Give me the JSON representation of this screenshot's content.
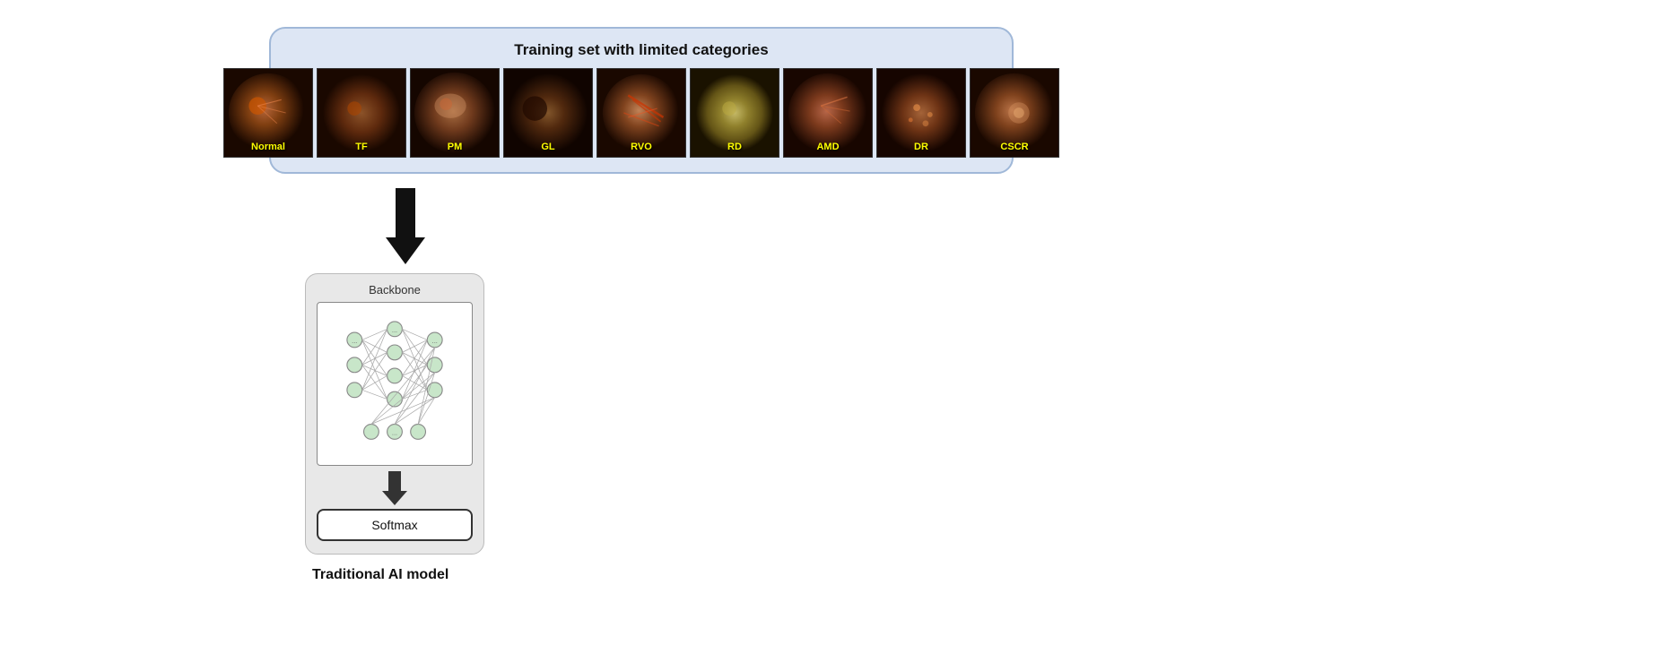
{
  "training_box": {
    "title": "Training set with limited categories"
  },
  "eye_images": [
    {
      "label": "Normal",
      "hue": "warm_brown",
      "id": "normal"
    },
    {
      "label": "TF",
      "hue": "dark_brown",
      "id": "tf"
    },
    {
      "label": "PM",
      "hue": "medium_brown",
      "id": "pm"
    },
    {
      "label": "GL",
      "hue": "dark",
      "id": "gl"
    },
    {
      "label": "RVO",
      "hue": "light_brown",
      "id": "rvo"
    },
    {
      "label": "RD",
      "hue": "yellow_green",
      "id": "rd"
    },
    {
      "label": "AMD",
      "hue": "red_brown",
      "id": "amd"
    },
    {
      "label": "DR",
      "hue": "brown",
      "id": "dr"
    },
    {
      "label": "CSCR",
      "hue": "orange_brown",
      "id": "cscr"
    }
  ],
  "backbone": {
    "title": "Backbone"
  },
  "softmax": {
    "label": "Softmax"
  },
  "model_label": "Traditional AI model"
}
